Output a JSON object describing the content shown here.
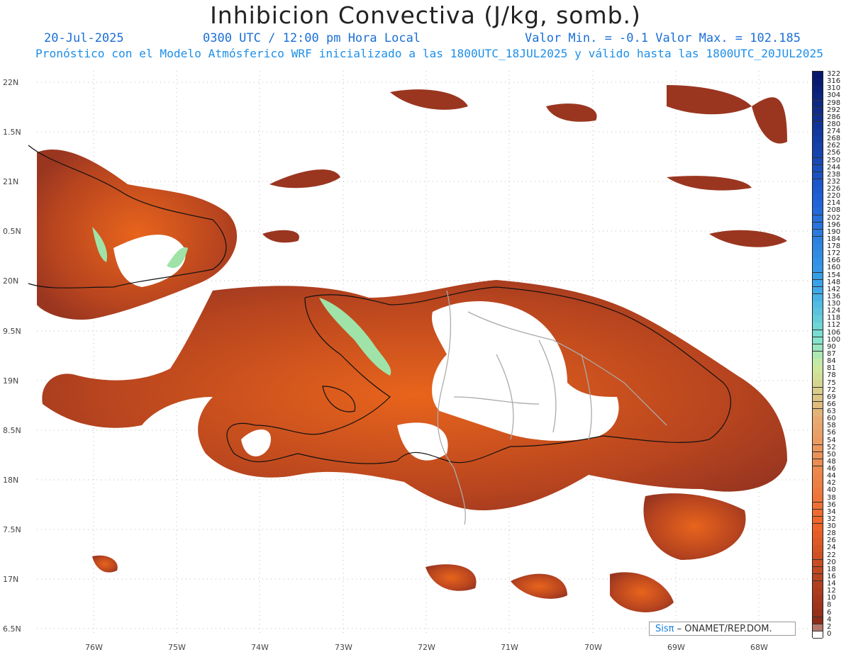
{
  "header": {
    "title": "Inhibicion Convectiva (J/kg, somb.)",
    "date": "20-Jul-2025",
    "time": "0300 UTC / 12:00 pm Hora Local",
    "minmax": "Valor Min. = -0.1  Valor Max. = 102.185",
    "forecast": "Pronóstico con el Modelo Atmósferico WRF inicializado a las 1800UTC_18JUL2025 y válido hasta las  1800UTC_20JUL2025"
  },
  "axes": {
    "y_labels": [
      "22N",
      "1.5N",
      "21N",
      "0.5N",
      "20N",
      "9.5N",
      "19N",
      "8.5N",
      "18N",
      "7.5N",
      "17N",
      "6.5N"
    ],
    "x_labels": [
      "76W",
      "75W",
      "74W",
      "73W",
      "72W",
      "71W",
      "70W",
      "69W",
      "68W"
    ]
  },
  "legend": {
    "labels": [
      "322",
      "316",
      "310",
      "304",
      "298",
      "292",
      "286",
      "280",
      "274",
      "268",
      "262",
      "256",
      "250",
      "244",
      "238",
      "232",
      "226",
      "220",
      "214",
      "208",
      "202",
      "196",
      "190",
      "184",
      "178",
      "172",
      "166",
      "160",
      "154",
      "148",
      "142",
      "136",
      "130",
      "124",
      "118",
      "112",
      "106",
      "100",
      "90",
      "87",
      "84",
      "81",
      "78",
      "75",
      "72",
      "69",
      "66",
      "63",
      "60",
      "58",
      "56",
      "54",
      "52",
      "50",
      "48",
      "46",
      "44",
      "42",
      "40",
      "38",
      "36",
      "34",
      "32",
      "30",
      "28",
      "26",
      "24",
      "22",
      "20",
      "18",
      "16",
      "14",
      "12",
      "10",
      "8",
      "6",
      "4",
      "2",
      "0"
    ],
    "colors": {
      "high": "#08176b",
      "mid": "#3aa6ea",
      "cyan": "#7fe3cf",
      "green": "#cdeaa0",
      "orange": "#f07030",
      "low": "#8b2a1a"
    }
  },
  "credit": {
    "sis": "Sisπ",
    "rest": " – ONAMET/REP.DOM."
  },
  "colors": {
    "field_dark": "#9a3620",
    "field_mid": "#b8451f",
    "field_orange": "#e8641c",
    "field_green": "#9fe3a8",
    "land_empty": "#ffffff",
    "border": "#111111",
    "province": "#aaaaaa"
  }
}
